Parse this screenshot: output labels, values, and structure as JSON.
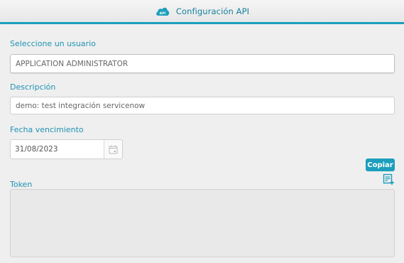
{
  "header": {
    "icon": "api-cloud-icon",
    "icon_text": "API",
    "title": "Configuración API"
  },
  "form": {
    "user_label": "Seleccione un usuario",
    "user_value": "APPLICATION ADMINISTRATOR",
    "description_label": "Descripción",
    "description_value": "demo: test integración servicenow",
    "expiry_label": "Fecha vencimiento",
    "expiry_value": "31/08/2023",
    "copy_label": "Copiar",
    "token_label": "Token",
    "token_value": ""
  },
  "colors": {
    "accent": "#1b9fbd",
    "label": "#1f93b3",
    "background": "#efefef"
  }
}
